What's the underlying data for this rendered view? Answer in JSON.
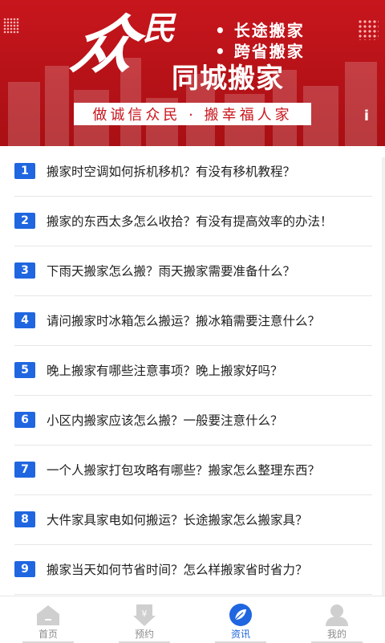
{
  "banner": {
    "brand_big": "众",
    "brand_small": "民",
    "feature_1": "• 长途搬家",
    "feature_2": "• 跨省搬家",
    "title": "同城搬家",
    "slogan": "做诚信众民 · 搬幸福人家",
    "info_icon": "i",
    "colors": {
      "banner_red": "#c8161d",
      "slogan_bg": "#ffffff"
    }
  },
  "articles": [
    {
      "num": "1",
      "title": "搬家时空调如何拆机移机？有没有移机教程？"
    },
    {
      "num": "2",
      "title": "搬家的东西太多怎么收拾？有没有提高效率的办法！"
    },
    {
      "num": "3",
      "title": "下雨天搬家怎么搬？雨天搬家需要准备什么？"
    },
    {
      "num": "4",
      "title": "请问搬家时冰箱怎么搬运？搬冰箱需要注意什么？"
    },
    {
      "num": "5",
      "title": "晚上搬家有哪些注意事项？晚上搬家好吗？"
    },
    {
      "num": "6",
      "title": "小区内搬家应该怎么搬？一般要注意什么？"
    },
    {
      "num": "7",
      "title": "一个人搬家打包攻略有哪些？搬家怎么整理东西？"
    },
    {
      "num": "8",
      "title": "大件家具家电如何搬运？长途搬家怎么搬家具？"
    },
    {
      "num": "9",
      "title": "搬家当天如何节省时间？怎么样搬家省时省力？"
    }
  ],
  "number_badge_color": "#1f66e0",
  "tabs": [
    {
      "label": "首页",
      "icon": "home-icon",
      "active": false
    },
    {
      "label": "预约",
      "icon": "yen-arrow-icon",
      "active": false
    },
    {
      "label": "资讯",
      "icon": "leaf-icon",
      "active": true
    },
    {
      "label": "我的",
      "icon": "user-icon",
      "active": false
    }
  ],
  "active_tab_color": "#1f66e0"
}
